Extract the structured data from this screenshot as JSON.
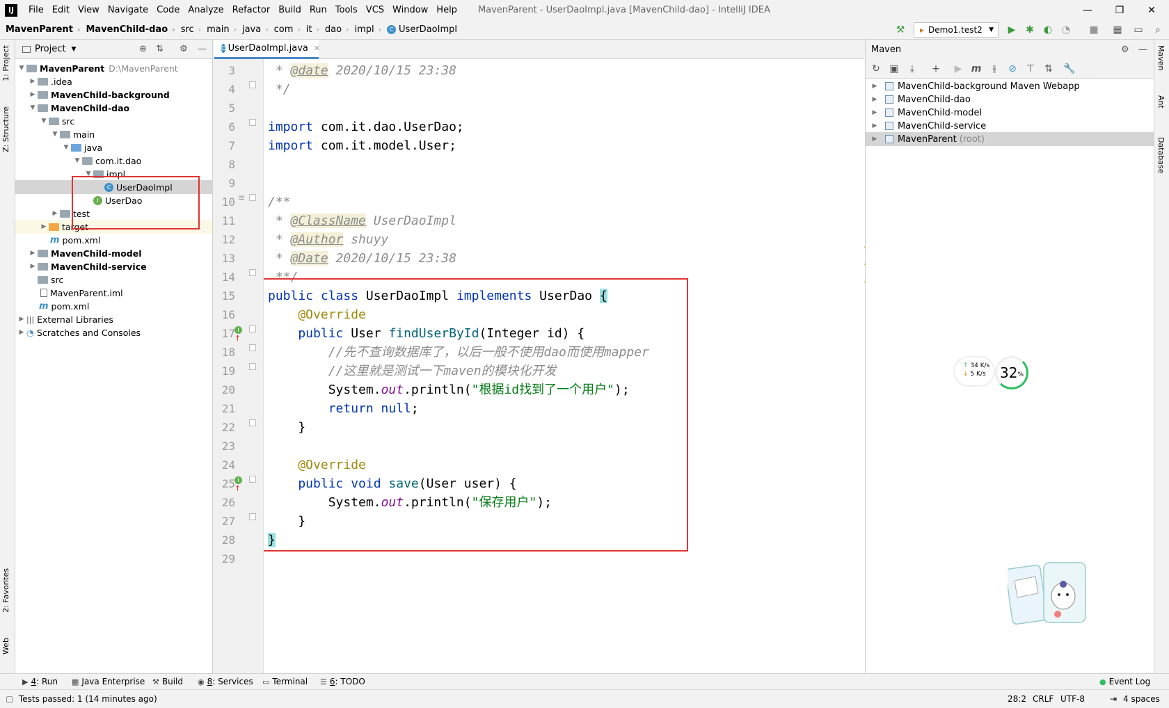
{
  "menubar": {
    "items": [
      "File",
      "Edit",
      "View",
      "Navigate",
      "Code",
      "Analyze",
      "Refactor",
      "Build",
      "Run",
      "Tools",
      "VCS",
      "Window",
      "Help"
    ],
    "window_title": "MavenParent - UserDaoImpl.java [MavenChild-dao] - IntelliJ IDEA"
  },
  "breadcrumbs": [
    "MavenParent",
    "MavenChild-dao",
    "src",
    "main",
    "java",
    "com",
    "it",
    "dao",
    "impl",
    "UserDaoImpl"
  ],
  "run_config": "Demo1.test2",
  "left_strip": {
    "project": "1: Project",
    "structure": "Z: Structure",
    "favorites": "2: Favorites",
    "web": "Web"
  },
  "project_panel": {
    "title": "Project",
    "tree": [
      {
        "label": "MavenParent",
        "hint": "D:\\MavenParent",
        "bold": true
      },
      {
        "label": ".idea"
      },
      {
        "label": "MavenChild-background",
        "bold": true
      },
      {
        "label": "MavenChild-dao",
        "bold": true
      },
      {
        "label": "src"
      },
      {
        "label": "main"
      },
      {
        "label": "java"
      },
      {
        "label": "com.it.dao"
      },
      {
        "label": "impl"
      },
      {
        "label": "UserDaoImpl"
      },
      {
        "label": "UserDao"
      },
      {
        "label": "test"
      },
      {
        "label": "target"
      },
      {
        "label": "pom.xml"
      },
      {
        "label": "MavenChild-model",
        "bold": true
      },
      {
        "label": "MavenChild-service",
        "bold": true
      },
      {
        "label": "src"
      },
      {
        "label": "MavenParent.iml"
      },
      {
        "label": "pom.xml"
      },
      {
        "label": "External Libraries"
      },
      {
        "label": "Scratches and Consoles"
      }
    ]
  },
  "editor": {
    "tab_label": "UserDaoImpl.java",
    "line_numbers": [
      "3",
      "4",
      "5",
      "6",
      "7",
      "8",
      "9",
      "10",
      "11",
      "12",
      "13",
      "14",
      "15",
      "16",
      "17",
      "18",
      "19",
      "20",
      "21",
      "22",
      "23",
      "24",
      "25",
      "26",
      "27",
      "28",
      "29"
    ]
  },
  "code": {
    "l3_star": " * ",
    "l3_tag": "@date",
    "l3_rest": " 2020/10/15 23:38",
    "l4": " */",
    "l6_kw": "import",
    "l6_rest": " com.it.dao.UserDao;",
    "l7_kw": "import",
    "l7_rest": " com.it.model.User;",
    "l10": "/**",
    "l11_star": " * ",
    "l11_tag": "@ClassName",
    "l11_rest": " UserDaoImpl",
    "l12_star": " * ",
    "l12_tag": "@Author",
    "l12_rest": " shuyy",
    "l13_star": " * ",
    "l13_tag": "@Date",
    "l13_rest": " 2020/10/15 23:38",
    "l14": " **/",
    "l15_kw1": "public class",
    "l15_name": " UserDaoImpl ",
    "l15_kw2": "implements",
    "l15_rest": " UserDao ",
    "l15_brace": "{",
    "l16": "    @Override",
    "l17_kw": "    public",
    "l17_type": " User ",
    "l17_fn": "findUserById",
    "l17_rest": "(Integer id) {",
    "l18": "        //先不查询数据库了，以后一般不使用dao而使用mapper",
    "l19": "        //这里就是测试一下maven的模块化开发",
    "l20_pre": "        System.",
    "l20_out": "out",
    "l20_mid": ".println(",
    "l20_str": "\"根据id找到了一个用户\"",
    "l20_end": ");",
    "l21_kw": "        return null",
    "l21_end": ";",
    "l22": "    }",
    "l24": "    @Override",
    "l25_kw": "    public void",
    "l25_fn": " save",
    "l25_rest": "(User user) {",
    "l26_pre": "        System.",
    "l26_out": "out",
    "l26_mid": ".println(",
    "l26_str": "\"保存用户\"",
    "l26_end": ");",
    "l27": "    }",
    "l28": "}"
  },
  "maven_panel": {
    "title": "Maven",
    "items": [
      {
        "label": "MavenChild-background Maven Webapp"
      },
      {
        "label": "MavenChild-dao"
      },
      {
        "label": "MavenChild-model"
      },
      {
        "label": "MavenChild-service"
      },
      {
        "label": "MavenParent",
        "suffix": "(root)"
      }
    ]
  },
  "right_strip": {
    "maven": "Maven",
    "ant": "Ant",
    "database": "Database"
  },
  "net_widget": {
    "up": "34  K/s",
    "down": "5   K/s",
    "percent": "32",
    "percent_unit": "%"
  },
  "bottom_tabs": {
    "run_num": "4",
    "run": ": Run",
    "java_enterprise": "Java Enterprise",
    "build": "Build",
    "services_num": "8",
    "services": ": Services",
    "terminal": "Terminal",
    "todo_num": "6",
    "todo": ": TODO",
    "event_log": "Event Log"
  },
  "status_bar": {
    "message": "Tests passed: 1 (14 minutes ago)",
    "position": "28:2",
    "line_sep": "CRLF",
    "encoding": "UTF-8",
    "indent": "4 spaces"
  }
}
